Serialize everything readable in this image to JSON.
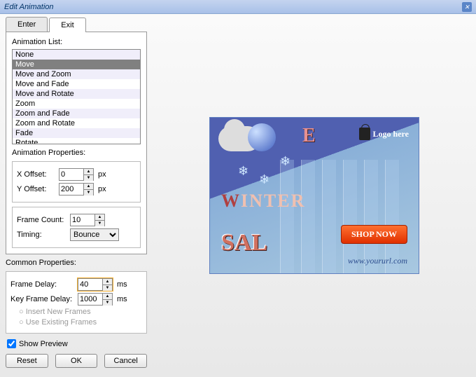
{
  "window": {
    "title": "Edit Animation"
  },
  "tabs": {
    "enter": "Enter",
    "exit": "Exit"
  },
  "animList": {
    "label": "Animation List:",
    "items": [
      "None",
      "Move",
      "Move and Zoom",
      "Move and Fade",
      "Move and Rotate",
      "Zoom",
      "Zoom and Fade",
      "Zoom and Rotate",
      "Fade",
      "Rotate"
    ],
    "selected": "Move"
  },
  "animProps": {
    "label": "Animation Properties:",
    "xoffset_label": "X Offset:",
    "xoffset": "0",
    "yoffset_label": "Y Offset:",
    "yoffset": "200",
    "px": "px",
    "framecount_label": "Frame Count:",
    "framecount": "10",
    "timing_label": "Timing:",
    "timing": "Bounce"
  },
  "common": {
    "label": "Common Properties:",
    "framedelay_label": "Frame Delay:",
    "framedelay": "40",
    "keyframedelay_label": "Key Frame Delay:",
    "keyframedelay": "1000",
    "ms": "ms",
    "radio1": "Insert New Frames",
    "radio2": "Use Existing Frames"
  },
  "showpreview": "Show Preview",
  "buttons": {
    "reset": "Reset",
    "ok": "OK",
    "cancel": "Cancel"
  },
  "banner": {
    "letter": "E",
    "logo": "Logo here",
    "winter": "WINTER",
    "sal": "SAL",
    "shop": "SHOP NOW",
    "url": "www.yoururl.com"
  }
}
